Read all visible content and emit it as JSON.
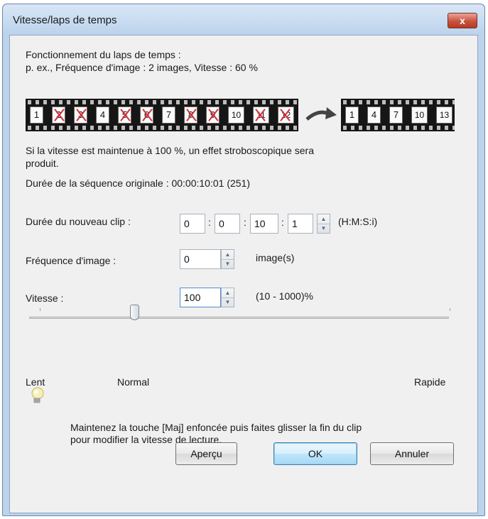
{
  "window": {
    "title": "Vitesse/laps de temps",
    "close_label": "x"
  },
  "info": {
    "line1": "Fonctionnement du laps de temps :",
    "line2": "p. ex., Fréquence d'image : 2 images, Vitesse : 60 %"
  },
  "film_original": {
    "frames": [
      {
        "label": "1",
        "crossed": false
      },
      {
        "label": "2",
        "crossed": true
      },
      {
        "label": "3",
        "crossed": true
      },
      {
        "label": "4",
        "crossed": false
      },
      {
        "label": "5",
        "crossed": true
      },
      {
        "label": "6",
        "crossed": true
      },
      {
        "label": "7",
        "crossed": false
      },
      {
        "label": "8",
        "crossed": true
      },
      {
        "label": "9",
        "crossed": true
      },
      {
        "label": "10",
        "crossed": false
      },
      {
        "label": "11",
        "crossed": true
      },
      {
        "label": "12",
        "crossed": true
      }
    ]
  },
  "film_result": {
    "frames": [
      "1",
      "4",
      "7",
      "10",
      "13"
    ]
  },
  "arrow_icon": "curved-arrow-right",
  "stroboscope_note": {
    "line1": "Si la vitesse est maintenue à 100 %, un effet stroboscopique sera",
    "line2": "produit."
  },
  "original_duration": "Durée de la séquence originale : 00:00:10:01 (251)",
  "new_clip": {
    "label": "Durée du nouveau clip :",
    "hours": "0",
    "minutes": "0",
    "seconds": "10",
    "frames": "1",
    "format": "(H:M:S:i)"
  },
  "frame_rate": {
    "label": "Fréquence d'image :",
    "value": "0",
    "unit": "image(s)"
  },
  "speed": {
    "label": "Vitesse :",
    "value": "100",
    "range": "(10 - 1000)%"
  },
  "slider": {
    "min_label": "Lent",
    "mid_label": "Normal",
    "max_label": "Rapide",
    "level": 0.25
  },
  "tip": {
    "icon": "lightbulb-icon",
    "line1": "Maintenez la touche [Maj] enfoncée puis faites glisser la fin du clip",
    "line2": "pour modifier la vitesse de lecture."
  },
  "buttons": {
    "preview": "Aperçu",
    "ok": "OK",
    "cancel": "Annuler"
  }
}
